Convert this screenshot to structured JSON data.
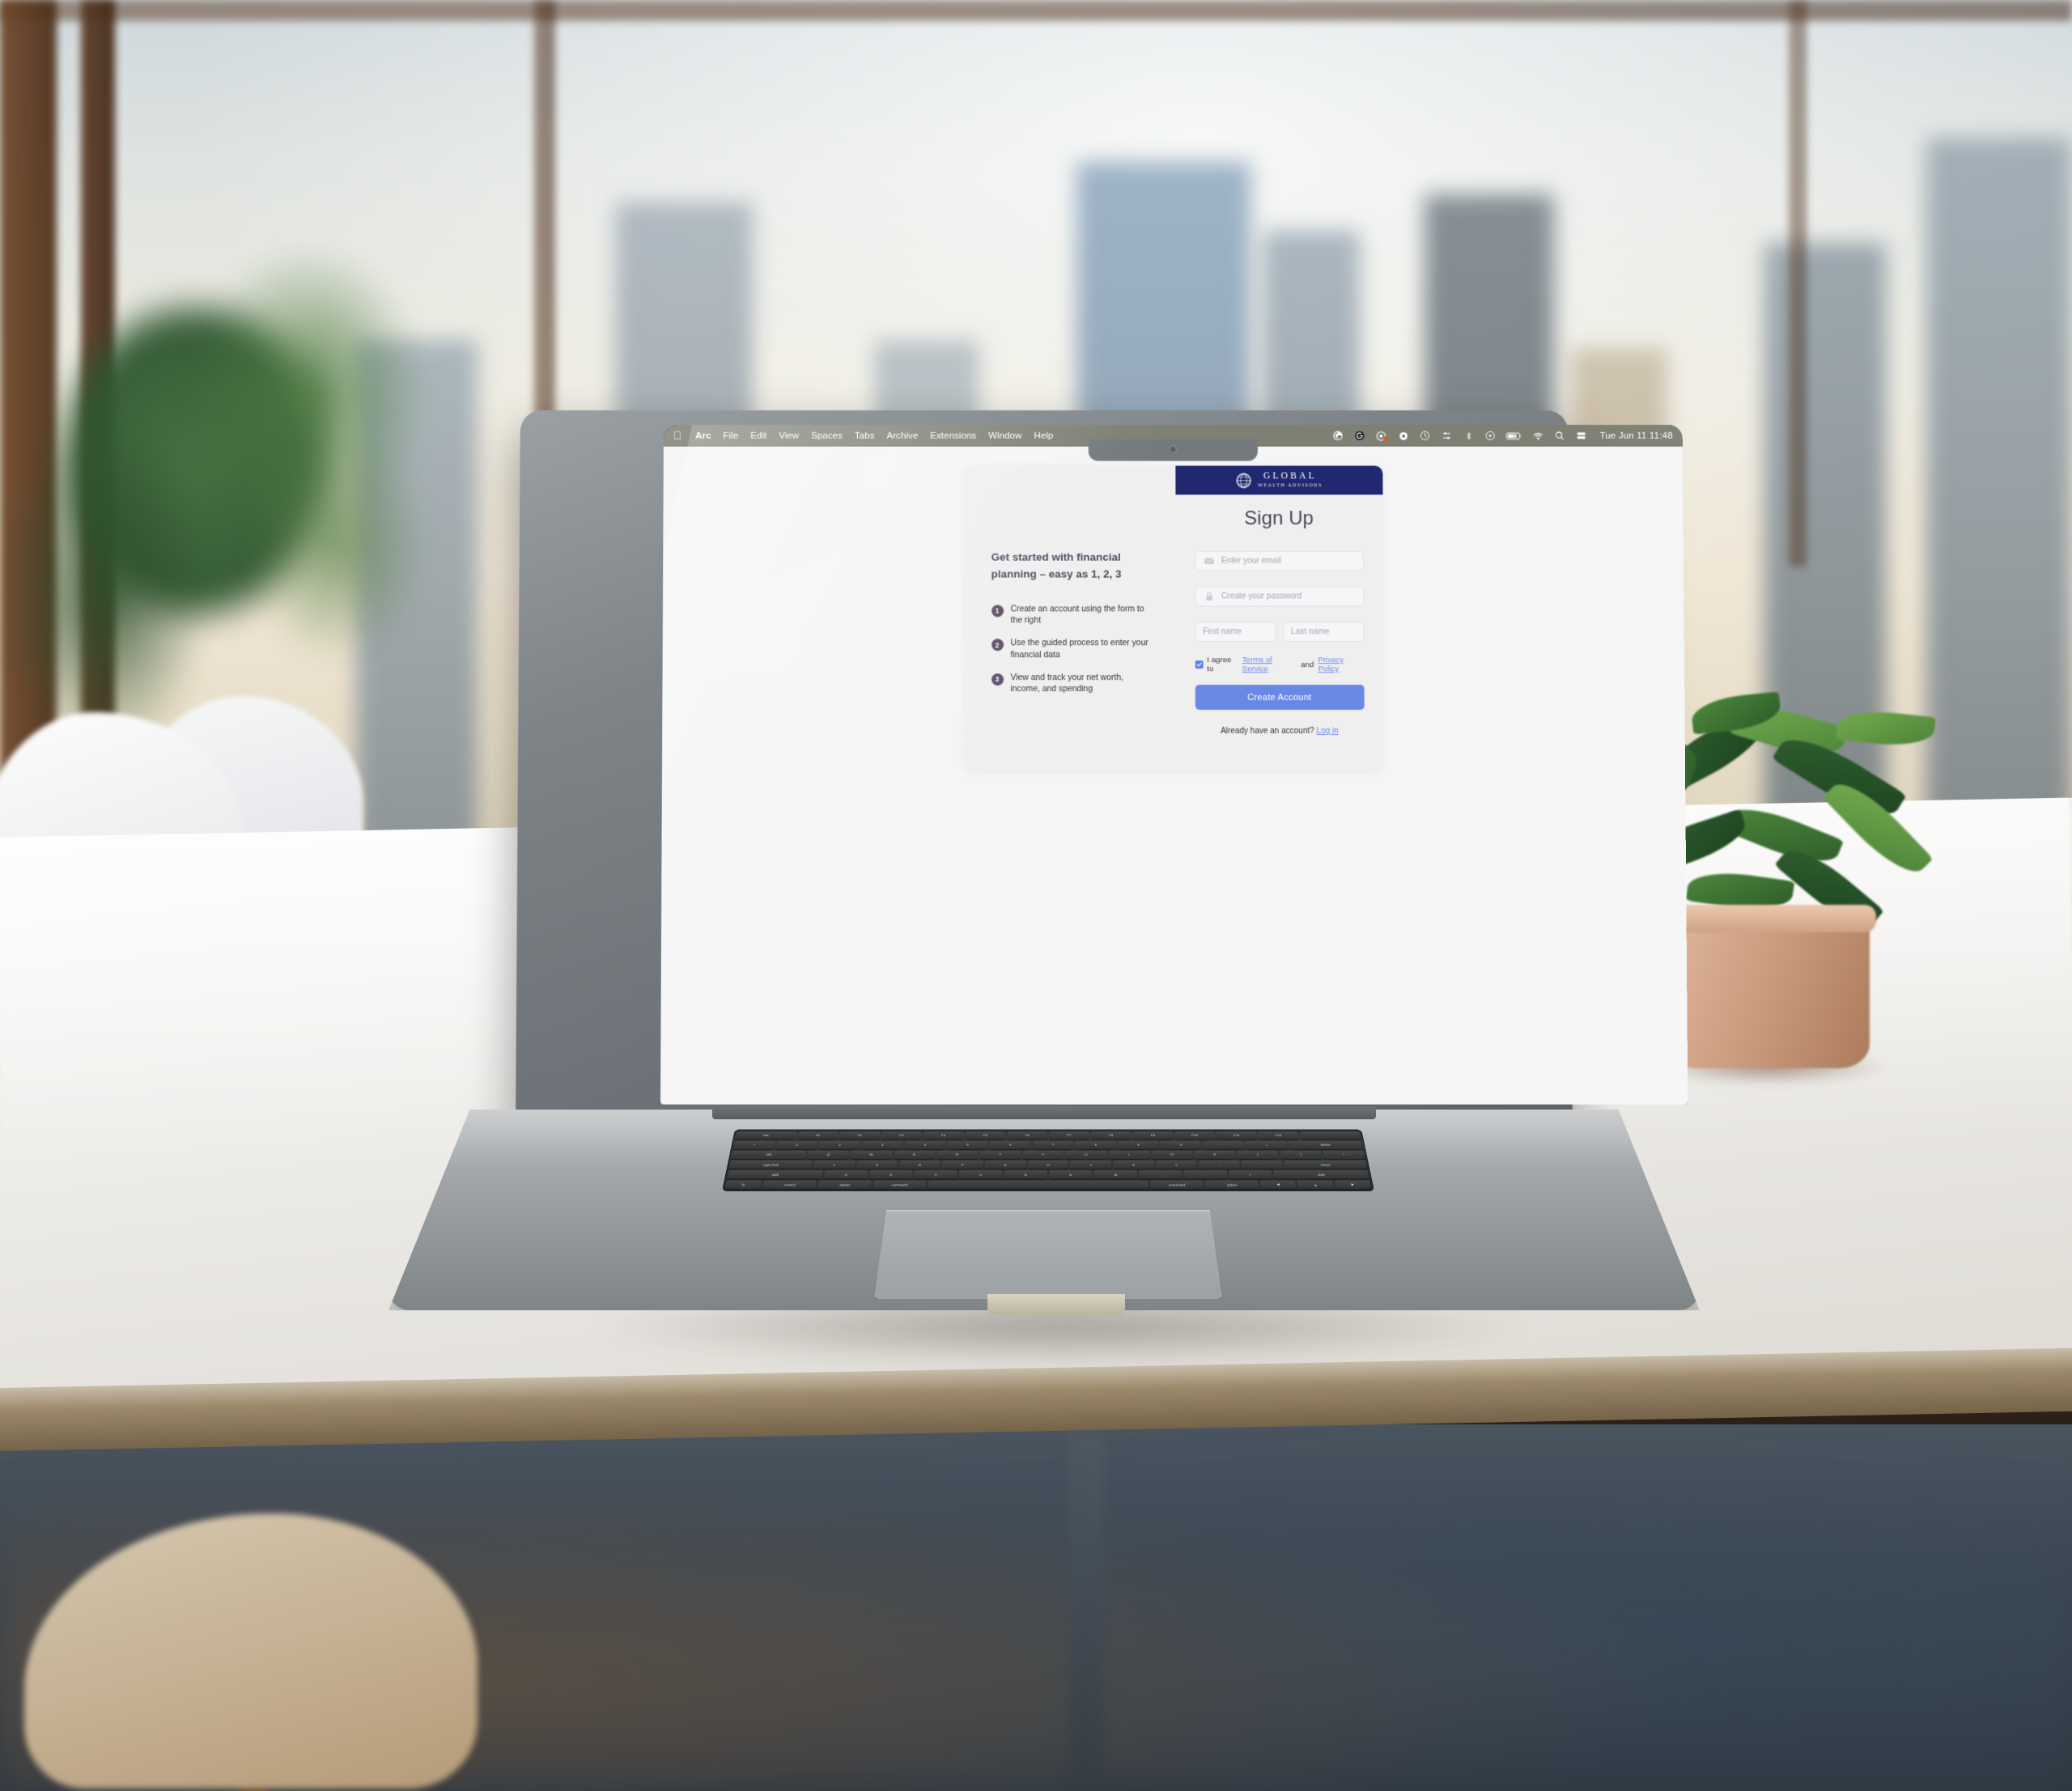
{
  "menubar": {
    "apple_glyph": "",
    "items": [
      "Arc",
      "File",
      "Edit",
      "View",
      "Spaces",
      "Tabs",
      "Archive",
      "Extensions",
      "Window",
      "Help"
    ],
    "status_icons": [
      "grammarly-icon",
      "logitech-icon",
      "screen-recording-icon",
      "arc-icon",
      "clock-icon",
      "control-center-icon",
      "bluetooth-icon",
      "now-playing-icon",
      "battery-charging-icon",
      "wifi-icon",
      "search-icon",
      "display-icon"
    ],
    "clock": "Tue Jun 11  11:48"
  },
  "brand": {
    "name": "GLOBAL",
    "tagline": "WEALTH ADVISORS",
    "logo_icon": "globe-icon",
    "bar_color": "#202870"
  },
  "left_panel": {
    "lede": "Get started with financial planning – easy as 1, 2, 3",
    "steps": [
      {
        "num": "1",
        "text": "Create an account using the form to the right"
      },
      {
        "num": "2",
        "text": "Use the guided process to enter your financial data"
      },
      {
        "num": "3",
        "text": "View and track your net worth, income, and spending"
      }
    ]
  },
  "form": {
    "title": "Sign Up",
    "email": {
      "placeholder": "Enter your email",
      "value": "",
      "icon": "envelope-icon"
    },
    "password": {
      "placeholder": "Create your password",
      "value": "",
      "icon": "lock-icon"
    },
    "first_name": {
      "placeholder": "First name",
      "value": ""
    },
    "last_name": {
      "placeholder": "Last name",
      "value": ""
    },
    "agree": {
      "checked": true,
      "prefix": "I agree to ",
      "terms_link": "Terms of Service",
      "conjunction": " and ",
      "privacy_link": "Privacy Policy"
    },
    "submit_label": "Create Account",
    "submit_color": "#6888e6",
    "footer_text": "Already have an account? ",
    "footer_link": "Log in",
    "link_color": "#6d8ae6"
  },
  "keyboard": {
    "row_fn": [
      "esc",
      "F1",
      "F2",
      "F3",
      "F4",
      "F5",
      "F6",
      "F7",
      "F8",
      "F9",
      "F10",
      "F11",
      "F12",
      ""
    ],
    "row_num": [
      "~",
      "1",
      "2",
      "3",
      "4",
      "5",
      "6",
      "7",
      "8",
      "9",
      "0",
      "-",
      "=",
      "delete"
    ],
    "row_q": [
      "tab",
      "Q",
      "W",
      "E",
      "R",
      "T",
      "Y",
      "U",
      "I",
      "O",
      "P",
      "[",
      "]",
      "\\"
    ],
    "row_a": [
      "caps lock",
      "A",
      "S",
      "D",
      "F",
      "G",
      "H",
      "J",
      "K",
      "L",
      ";",
      "'",
      "return"
    ],
    "row_z": [
      "shift",
      "Z",
      "X",
      "C",
      "V",
      "B",
      "N",
      "M",
      ",",
      ".",
      "/",
      "shift"
    ],
    "row_sp": [
      "fn",
      "control",
      "option",
      "command",
      "",
      "command",
      "option",
      "◀",
      "▲",
      "▶"
    ]
  }
}
